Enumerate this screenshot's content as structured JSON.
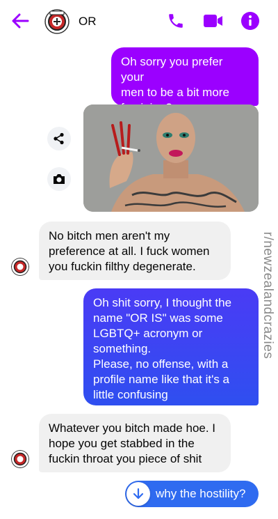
{
  "header": {
    "contact_name": "OR",
    "icons": [
      "back-arrow-icon",
      "phone-icon",
      "video-camera-icon",
      "info-icon"
    ],
    "accent_color": "#9b00ff"
  },
  "messages": [
    {
      "side": "outgoing",
      "text": "Oh sorry you prefer your\nmen to be a bit more\nfeminine?"
    },
    {
      "side": "outgoing",
      "type": "image",
      "description_icons": [
        "share-icon",
        "camera-icon"
      ]
    },
    {
      "side": "incoming",
      "text": "No bitch men aren't my\npreference at all. I fuck women\nyou fuckin filthy degenerate."
    },
    {
      "side": "outgoing",
      "text": "Oh shit sorry, I thought the\nname \"OR IS\" was some\nLGBTQ+ acronym or\nsomething.\nPlease, no offense, with a\nprofile name like that it's a\nlittle confusing"
    },
    {
      "side": "incoming",
      "text": "Whatever you bitch made hoe. I\nhope you get stabbed in the\nfuckin throat you piece of shit"
    },
    {
      "side": "outgoing",
      "text": "why the hostility?"
    }
  ],
  "watermark": "r/newzealandcrazies",
  "colors": {
    "outgoing_top": "#9b00ff",
    "outgoing_mid": "#3d3cf2",
    "outgoing_bottom": "#2f6bf0",
    "incoming": "#f0f0f0"
  }
}
